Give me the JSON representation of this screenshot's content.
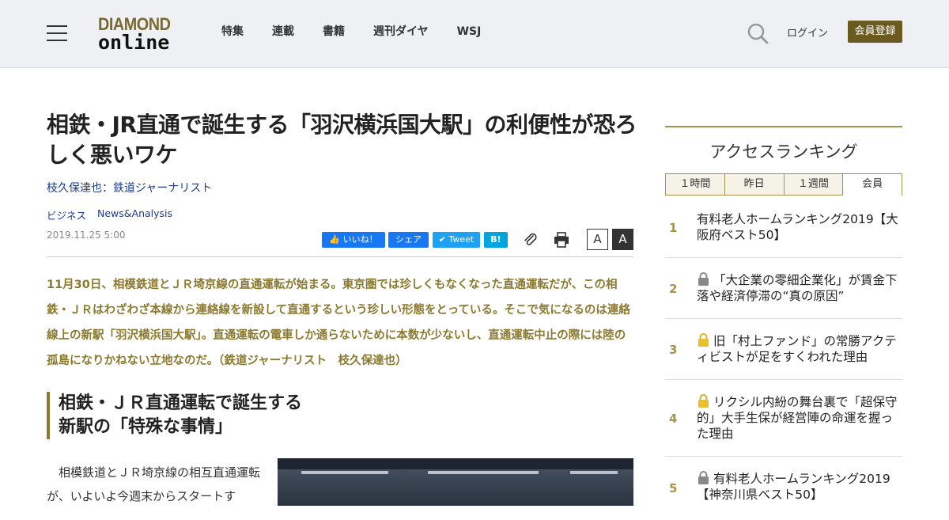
{
  "header": {
    "logo_line1": "DIAMOND",
    "logo_line2": "online",
    "nav": [
      "特集",
      "連載",
      "書籍",
      "週刊ダイヤ",
      "WSJ"
    ],
    "login": "ログイン",
    "register": "会員登録"
  },
  "article": {
    "title": "相鉄・JR直通で誕生する「羽沢横浜国大駅」の利便性が恐ろしく悪いワケ",
    "author": "枝久保達也：鉄道ジャーナリスト",
    "tags": [
      "ビジネス",
      "News&Analysis"
    ],
    "date": "2019.11.25 5:00",
    "social": {
      "like": "いいね！",
      "share": "シェア",
      "tweet": "Tweet",
      "hatena": "B!"
    },
    "font_small": "A",
    "font_large": "A",
    "lead": "11月30日、相模鉄道とＪＲ埼京線の直通運転が始まる。東京圏では珍しくもなくなった直通運転だが、この相鉄・ＪＲはわざわざ本線から連絡線を新設して直通するという珍しい形態をとっている。そこで気になるのは連絡線上の新駅「羽沢横浜国大駅」。直通運転の電車しか通らないために本数が少ないし、直通運転中止の際には陸の孤島になりかねない立地なのだ。（鉄道ジャーナリスト　枝久保達也）",
    "subheading_line1": "相鉄・ＪＲ直通運転で誕生する",
    "subheading_line2": "新駅の「特殊な事情」",
    "body": "相模鉄道とＪＲ埼京線の相互直通運転が、いよいよ今週末からスタートす"
  },
  "sidebar": {
    "title": "アクセスランキング",
    "tabs": [
      "１時間",
      "昨日",
      "１週間",
      "会員"
    ],
    "items": [
      {
        "rank": "1",
        "text": "有料老人ホームランキング2019【大阪府ベスト50】",
        "lock": "none"
      },
      {
        "rank": "2",
        "text": "「大企業の零細企業化」が賃金下落や経済停滞の“真の原因”",
        "lock": "gray"
      },
      {
        "rank": "3",
        "text": "旧「村上ファンド」の常勝アクティビストが足をすくわれた理由",
        "lock": "gold"
      },
      {
        "rank": "4",
        "text": "リクシル内紛の舞台裏で「超保守的」大手生保が経営陣の命運を握った理由",
        "lock": "gold"
      },
      {
        "rank": "5",
        "text": "有料老人ホームランキング2019【神奈川県ベスト50】",
        "lock": "gray"
      }
    ]
  },
  "colors": {
    "accent_gold": "#8b7a2e",
    "link_blue": "#1f3c8c",
    "register_bg": "#6b5a1f"
  }
}
